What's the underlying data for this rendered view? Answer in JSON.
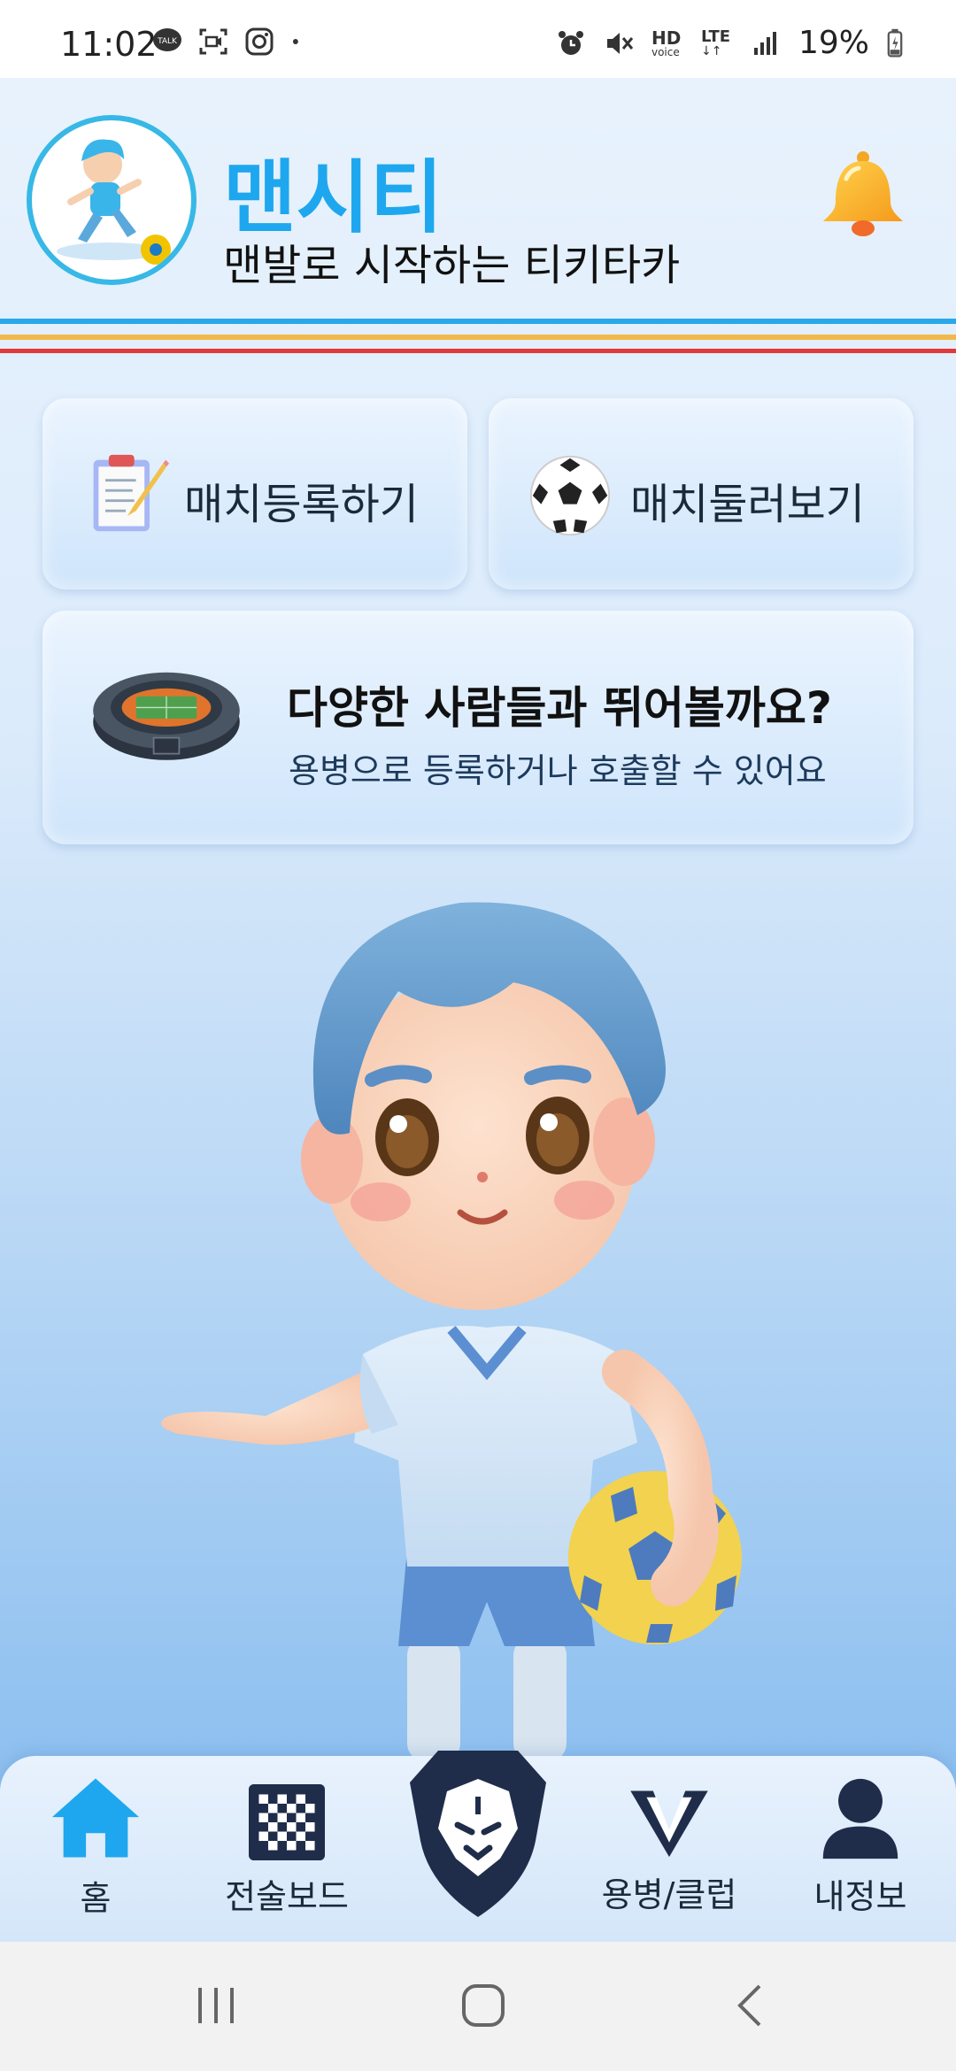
{
  "status_bar": {
    "time": "11:02",
    "left_icons": [
      "kakaotalk-icon",
      "screen-record-icon",
      "instagram-icon",
      "dot-icon"
    ],
    "right_icons": [
      "alarm-icon",
      "mute-icon",
      "hd-voice-icon",
      "lte-icon",
      "signal-icon"
    ],
    "hd_text": "HD",
    "voice_text": "voice",
    "lte_text": "LTE",
    "battery": "19%"
  },
  "header": {
    "title": "맨시티",
    "subtitle": "맨발로 시작하는 티키타카"
  },
  "cards": {
    "register_label": "매치등록하기",
    "browse_label": "매치둘러보기",
    "mercenary_title": "다양한 사람들과 뛰어볼까요?",
    "mercenary_sub": "용병으로 등록하거나 호출할 수 있어요"
  },
  "nav": {
    "items": [
      {
        "label": "홈",
        "icon": "home-icon"
      },
      {
        "label": "전술보드",
        "icon": "checkerboard-icon"
      },
      {
        "label": "",
        "icon": "lion-icon"
      },
      {
        "label": "용병/클럽",
        "icon": "v-logo-icon"
      },
      {
        "label": "내정보",
        "icon": "person-icon"
      }
    ]
  },
  "colors": {
    "accent": "#1ea7ee",
    "home_icon": "#1ea7ee",
    "nav_dark": "#1f2d4a",
    "stripe_blue": "#29a8ea",
    "stripe_yellow": "#f2b84b",
    "stripe_red": "#e23a3a"
  }
}
